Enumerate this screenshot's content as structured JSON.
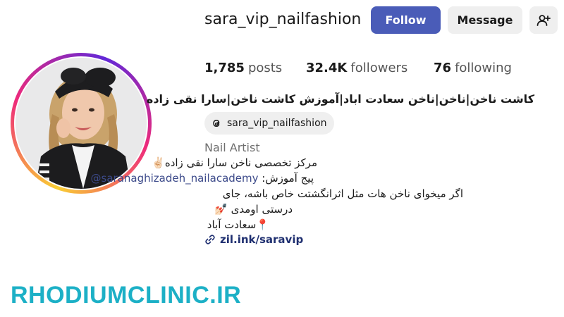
{
  "profile": {
    "username": "sara_vip_nailfashion",
    "full_name": "کاشت ناخن|ناخن|ناخن سعادت اباد|آموزش کاشت ناخن|سارا نقی زاده",
    "threads_handle": "sara_vip_nailfashion",
    "category": "Nail Artist",
    "bio": {
      "line1": "مرکز تخصصی ناخن سارا نقی زاده✌🏻",
      "line2_prefix": "پیج آموزش: ",
      "line2_handle": "@saranaghizadeh_nailacademy",
      "line3": "اگر میخوای ناخن هات مثل اثرانگشتت خاص باشه، جای",
      "line4": "درستی اومدی 💅🏻",
      "line5": "📍سعادت آباد"
    },
    "link": "zil.ink/saravip"
  },
  "actions": {
    "follow_label": "Follow",
    "message_label": "Message"
  },
  "stats": {
    "posts_count": "1,785",
    "posts_label": "posts",
    "followers_count": "32.4K",
    "followers_label": "followers",
    "following_count": "76",
    "following_label": "following"
  },
  "watermark": "RHODIUMCLINIC.IR",
  "icons": {
    "add_user": "add-user-icon",
    "threads": "threads-icon",
    "link": "link-icon"
  },
  "colors": {
    "follow_button": "#4a5cb8",
    "secondary_button": "#efefef",
    "watermark": "#1cb0c6",
    "link": "#1f2f70"
  }
}
